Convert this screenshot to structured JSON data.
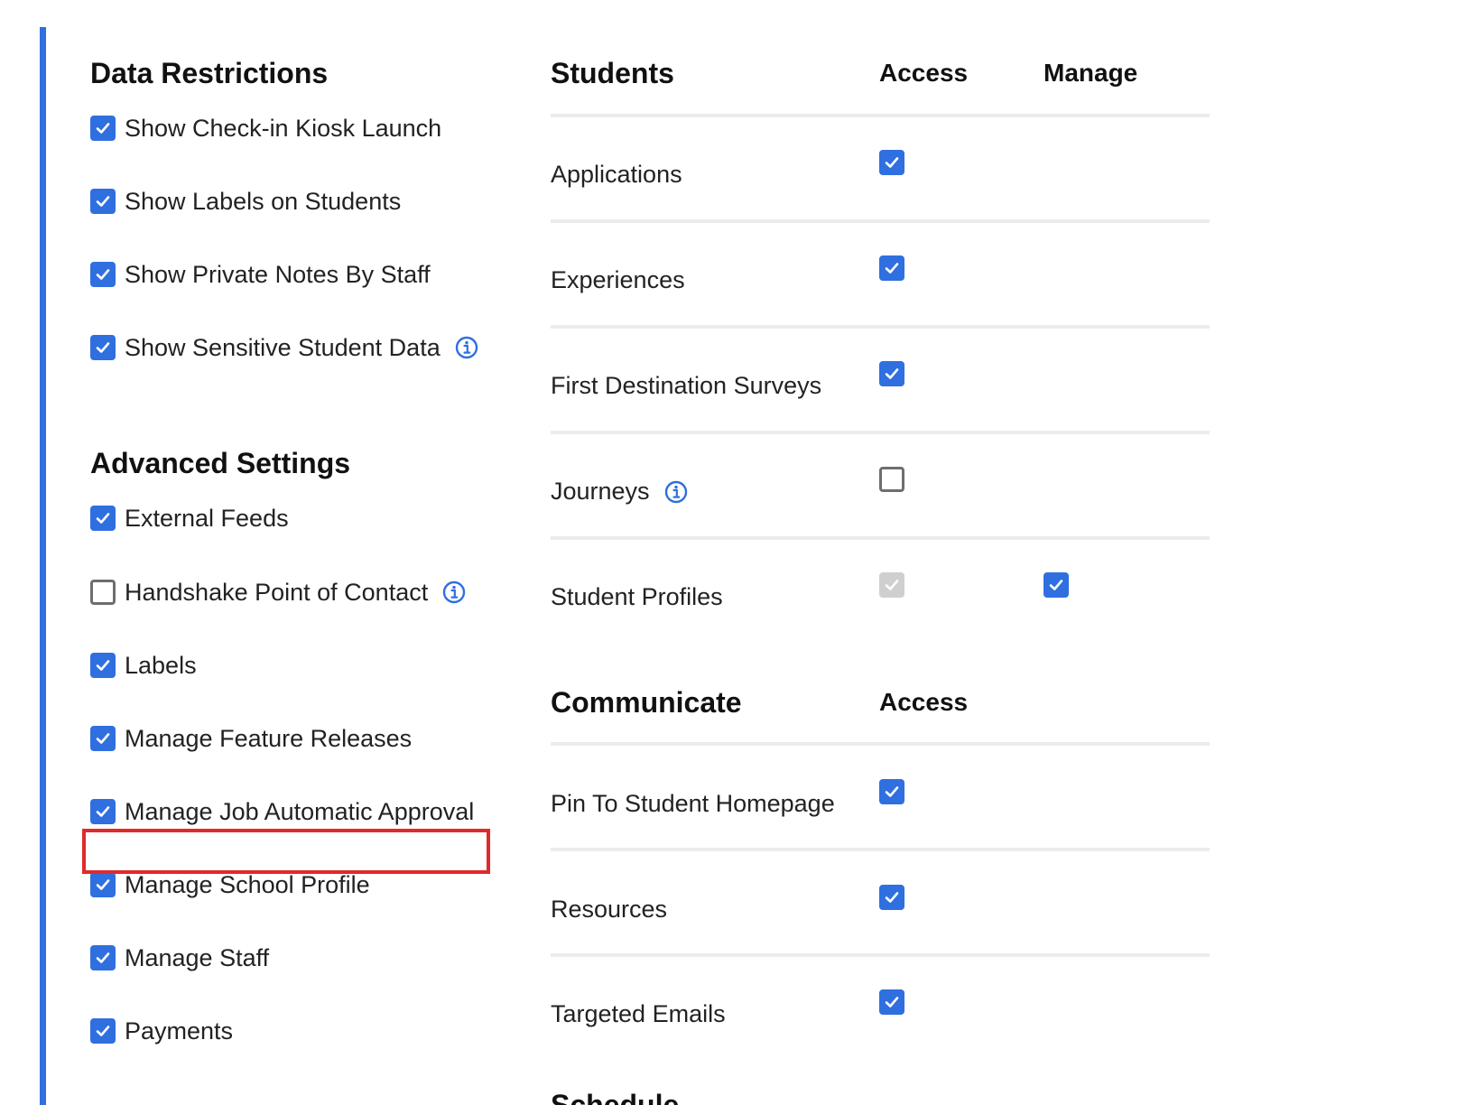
{
  "colors": {
    "accent": "#2f6fe0",
    "checkbox_checked": "#2f6fe0",
    "checkbox_disabled": "#cfcfcf",
    "highlight_border": "#e02a2a",
    "divider": "#ececec"
  },
  "data_restrictions": {
    "title": "Data Restrictions",
    "items": [
      {
        "label": "Show Check-in Kiosk Launch",
        "checked": true
      },
      {
        "label": "Show Labels on Students",
        "checked": true
      },
      {
        "label": "Show Private Notes By Staff",
        "checked": true
      },
      {
        "label": "Show Sensitive Student Data",
        "checked": true,
        "info_icon": "info-icon"
      }
    ]
  },
  "advanced_settings": {
    "title": "Advanced Settings",
    "items": [
      {
        "label": "External Feeds",
        "checked": true
      },
      {
        "label": "Handshake Point of Contact",
        "checked": false,
        "info_icon": "info-icon"
      },
      {
        "label": "Labels",
        "checked": true
      },
      {
        "label": "Manage Feature Releases",
        "checked": true
      },
      {
        "label": "Manage Job Automatic Approval",
        "checked": true,
        "highlighted": true
      },
      {
        "label": "Manage School Profile",
        "checked": true
      },
      {
        "label": "Manage Staff",
        "checked": true
      },
      {
        "label": "Payments",
        "checked": true
      }
    ]
  },
  "students": {
    "title": "Students",
    "col_access": "Access",
    "col_manage": "Manage",
    "rows": [
      {
        "label": "Applications",
        "access": "checked"
      },
      {
        "label": "Experiences",
        "access": "checked"
      },
      {
        "label": "First Destination Surveys",
        "access": "checked"
      },
      {
        "label": "Journeys",
        "access": "unchecked",
        "info_icon": "info-icon"
      },
      {
        "label": "Student Profiles",
        "access": "disabled",
        "manage": "checked"
      }
    ]
  },
  "communicate": {
    "title": "Communicate",
    "col_access": "Access",
    "rows": [
      {
        "label": "Pin To Student Homepage",
        "access": "checked"
      },
      {
        "label": "Resources",
        "access": "checked"
      },
      {
        "label": "Targeted Emails",
        "access": "checked"
      }
    ]
  },
  "next_section": {
    "title": "Schedule"
  }
}
